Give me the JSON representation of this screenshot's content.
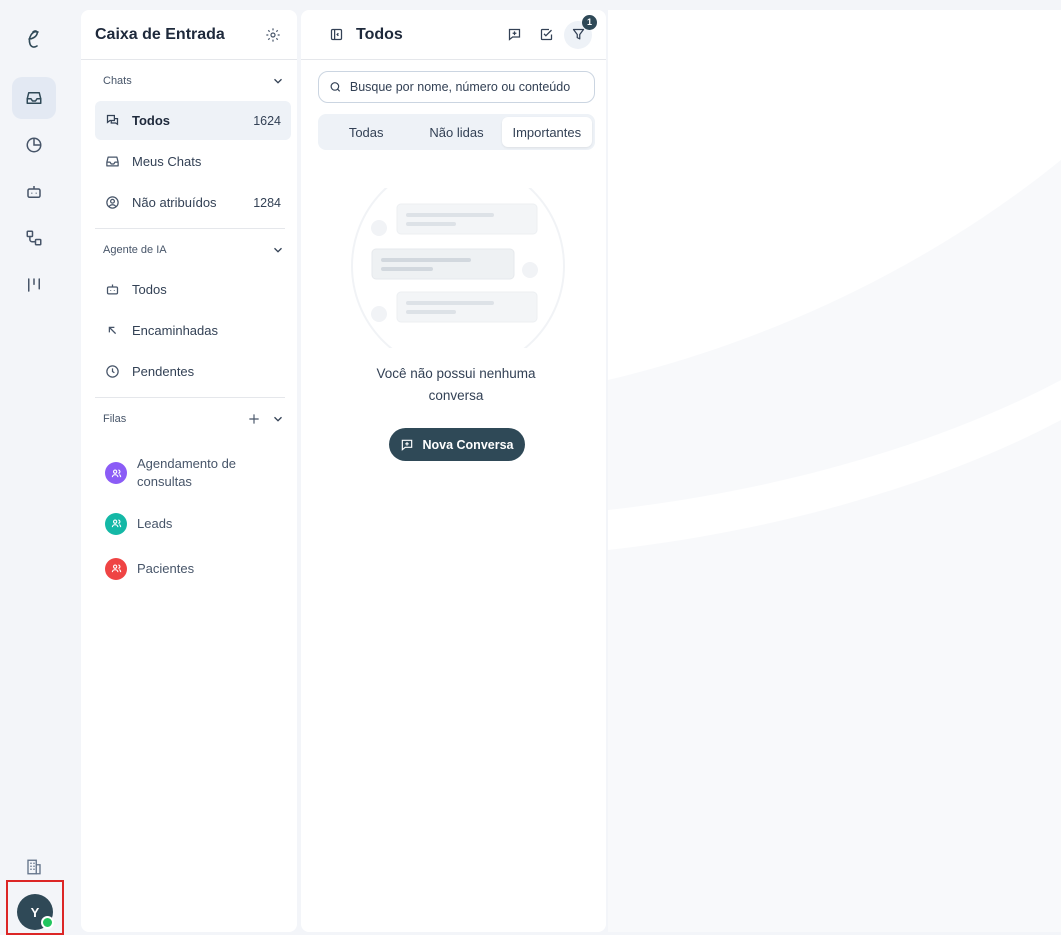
{
  "rail": {
    "items": [
      "inbox-icon",
      "chart-icon",
      "bot-icon",
      "workflow-icon",
      "columns-icon"
    ],
    "bottom": [
      "building-icon"
    ],
    "avatar_initial": "Y"
  },
  "inbox": {
    "title": "Caixa de Entrada",
    "chats": {
      "label": "Chats",
      "items": [
        {
          "label": "Todos",
          "count": "1624"
        },
        {
          "label": "Meus Chats",
          "count": ""
        },
        {
          "label": "Não atribuídos",
          "count": "1284"
        }
      ]
    },
    "ai_agent": {
      "label": "Agente de IA",
      "items": [
        {
          "label": "Todos"
        },
        {
          "label": "Encaminhadas"
        },
        {
          "label": "Pendentes"
        }
      ]
    },
    "queues": {
      "label": "Filas",
      "items": [
        {
          "label": "Agendamento de consultas",
          "color": "#8b5cf6"
        },
        {
          "label": "Leads",
          "color": "#14b8a6"
        },
        {
          "label": "Pacientes",
          "color": "#ef4444"
        }
      ]
    }
  },
  "list": {
    "title": "Todos",
    "filter_badge": "1",
    "search_placeholder": "Busque por nome, número ou conteúdo",
    "tabs": [
      "Todas",
      "Não lidas",
      "Importantes"
    ],
    "active_tab": "Importantes",
    "empty_text": "Você não possui nenhuma conversa",
    "new_button": "Nova Conversa"
  },
  "colors": {
    "accent": "#2f4957",
    "online": "#22c55e"
  }
}
